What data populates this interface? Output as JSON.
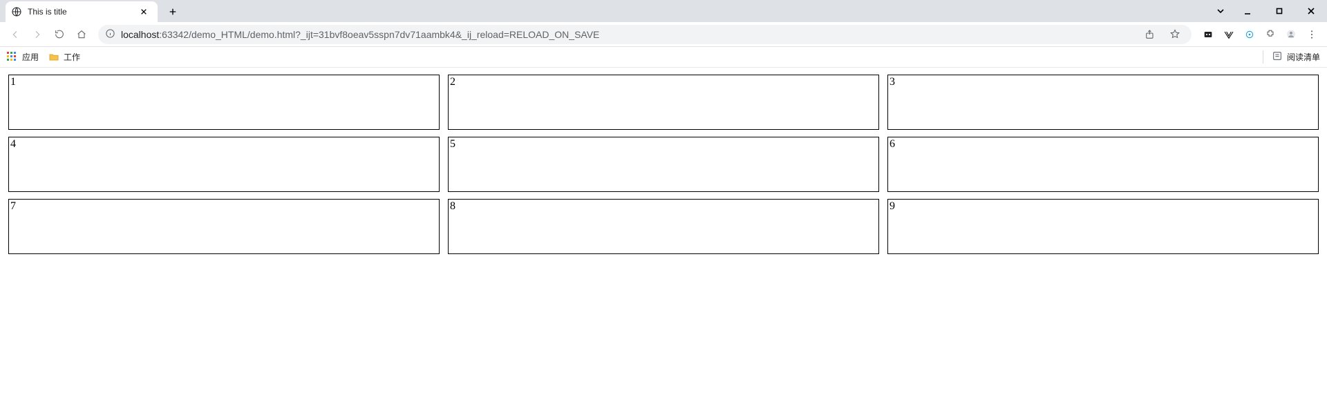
{
  "tab": {
    "title": "This is title"
  },
  "url": {
    "host": "localhost",
    "port": ":63342",
    "path": "/demo_HTML/demo.html?_ijt=31bvf8oeav5sspn7dv71aambk4&_ij_reload=RELOAD_ON_SAVE"
  },
  "bookmarks": {
    "apps_label": "应用",
    "work_folder_label": "工作",
    "reading_list_label": "阅读清单"
  },
  "grid": {
    "cells": [
      "1",
      "2",
      "3",
      "4",
      "5",
      "6",
      "7",
      "8",
      "9"
    ]
  }
}
